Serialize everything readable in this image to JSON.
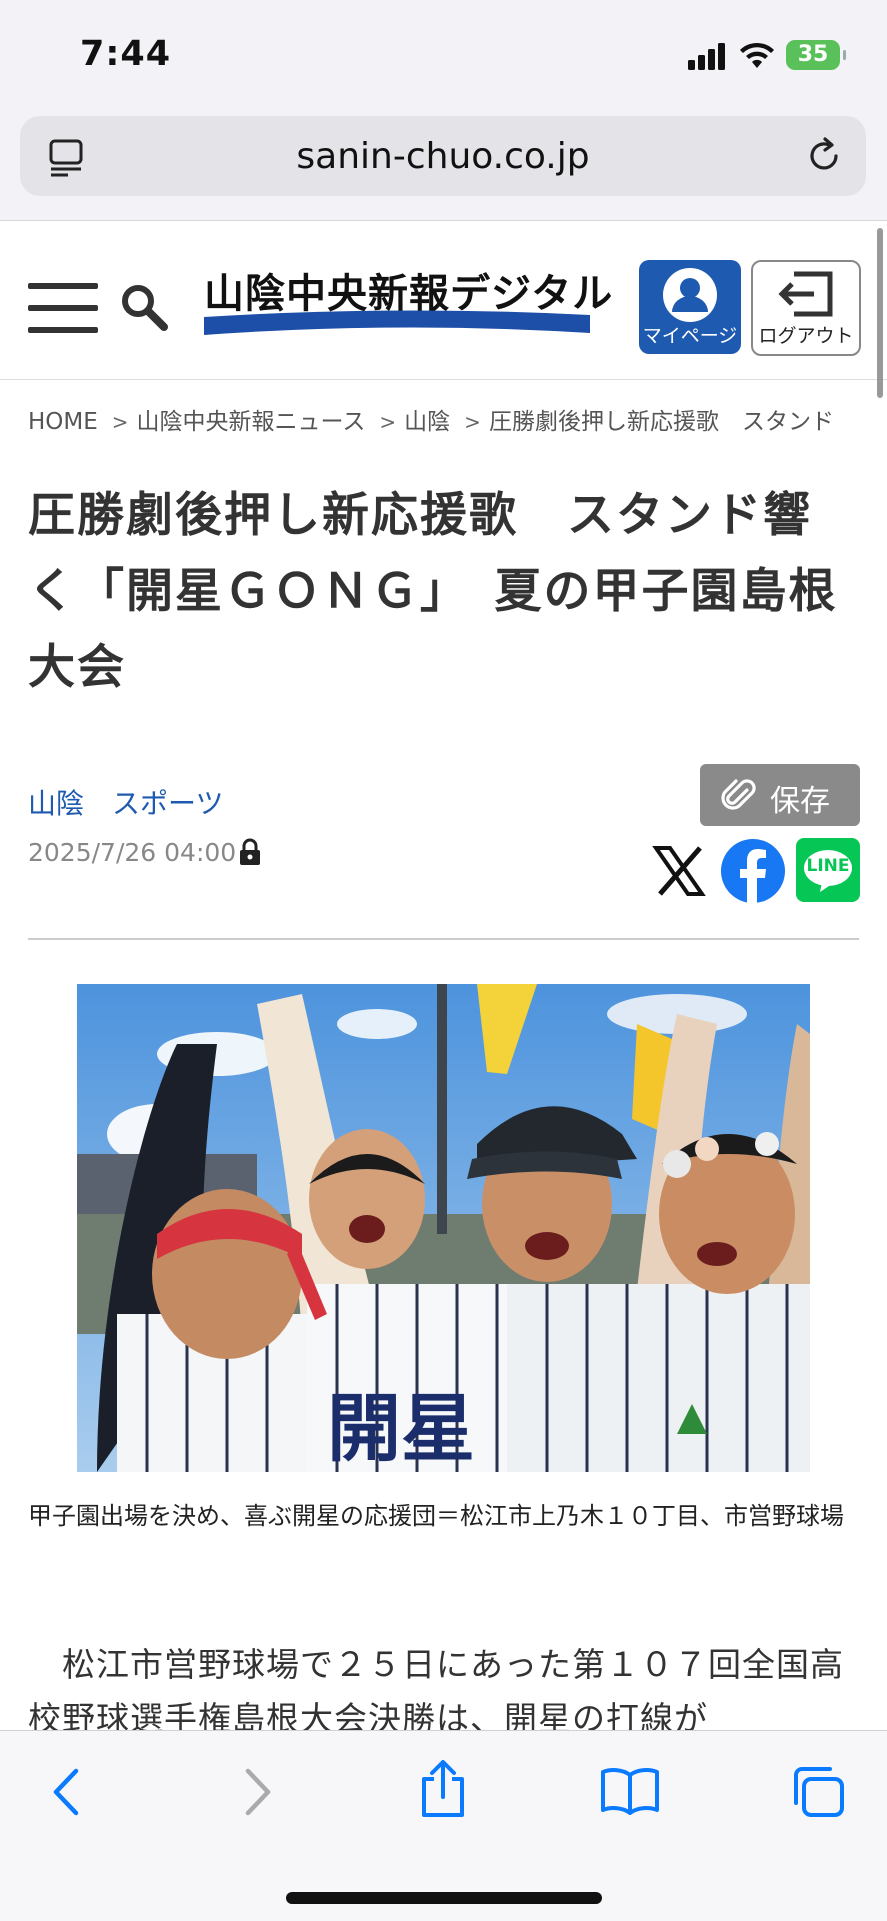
{
  "status": {
    "time": "7:44",
    "battery": "35"
  },
  "browser": {
    "url": "sanin-chuo.co.jp"
  },
  "header": {
    "logo_text": "山陰中央新報デジタル",
    "mypage_label": "マイページ",
    "logout_label": "ログアウト"
  },
  "breadcrumb": [
    "HOME",
    "山陰中央新報ニュース",
    "山陰",
    "圧勝劇後押し新応援歌　スタンド"
  ],
  "article": {
    "headline": "圧勝劇後押し新応援歌　スタンド響く「開星ＧＯＮＧ」　夏の甲子園島根大会",
    "categories": [
      "山陰",
      "スポーツ"
    ],
    "date": "2025/7/26 04:00",
    "save_label": "保存",
    "caption": "甲子園出場を決め、喜ぶ開星の応援団＝松江市上乃木１０丁目、市営野球場",
    "body": "　松江市営野球場で２５日にあった第１０７回全国高校野球選手権島根大会決勝は、開星の打線が"
  },
  "share": {
    "line_label": "LINE"
  },
  "photo": {
    "uniform_text": "開星"
  },
  "colors": {
    "brand_blue": "#1e5bb0",
    "facebook": "#1877f2",
    "line": "#06c755",
    "safari_blue": "#0a7aff"
  }
}
